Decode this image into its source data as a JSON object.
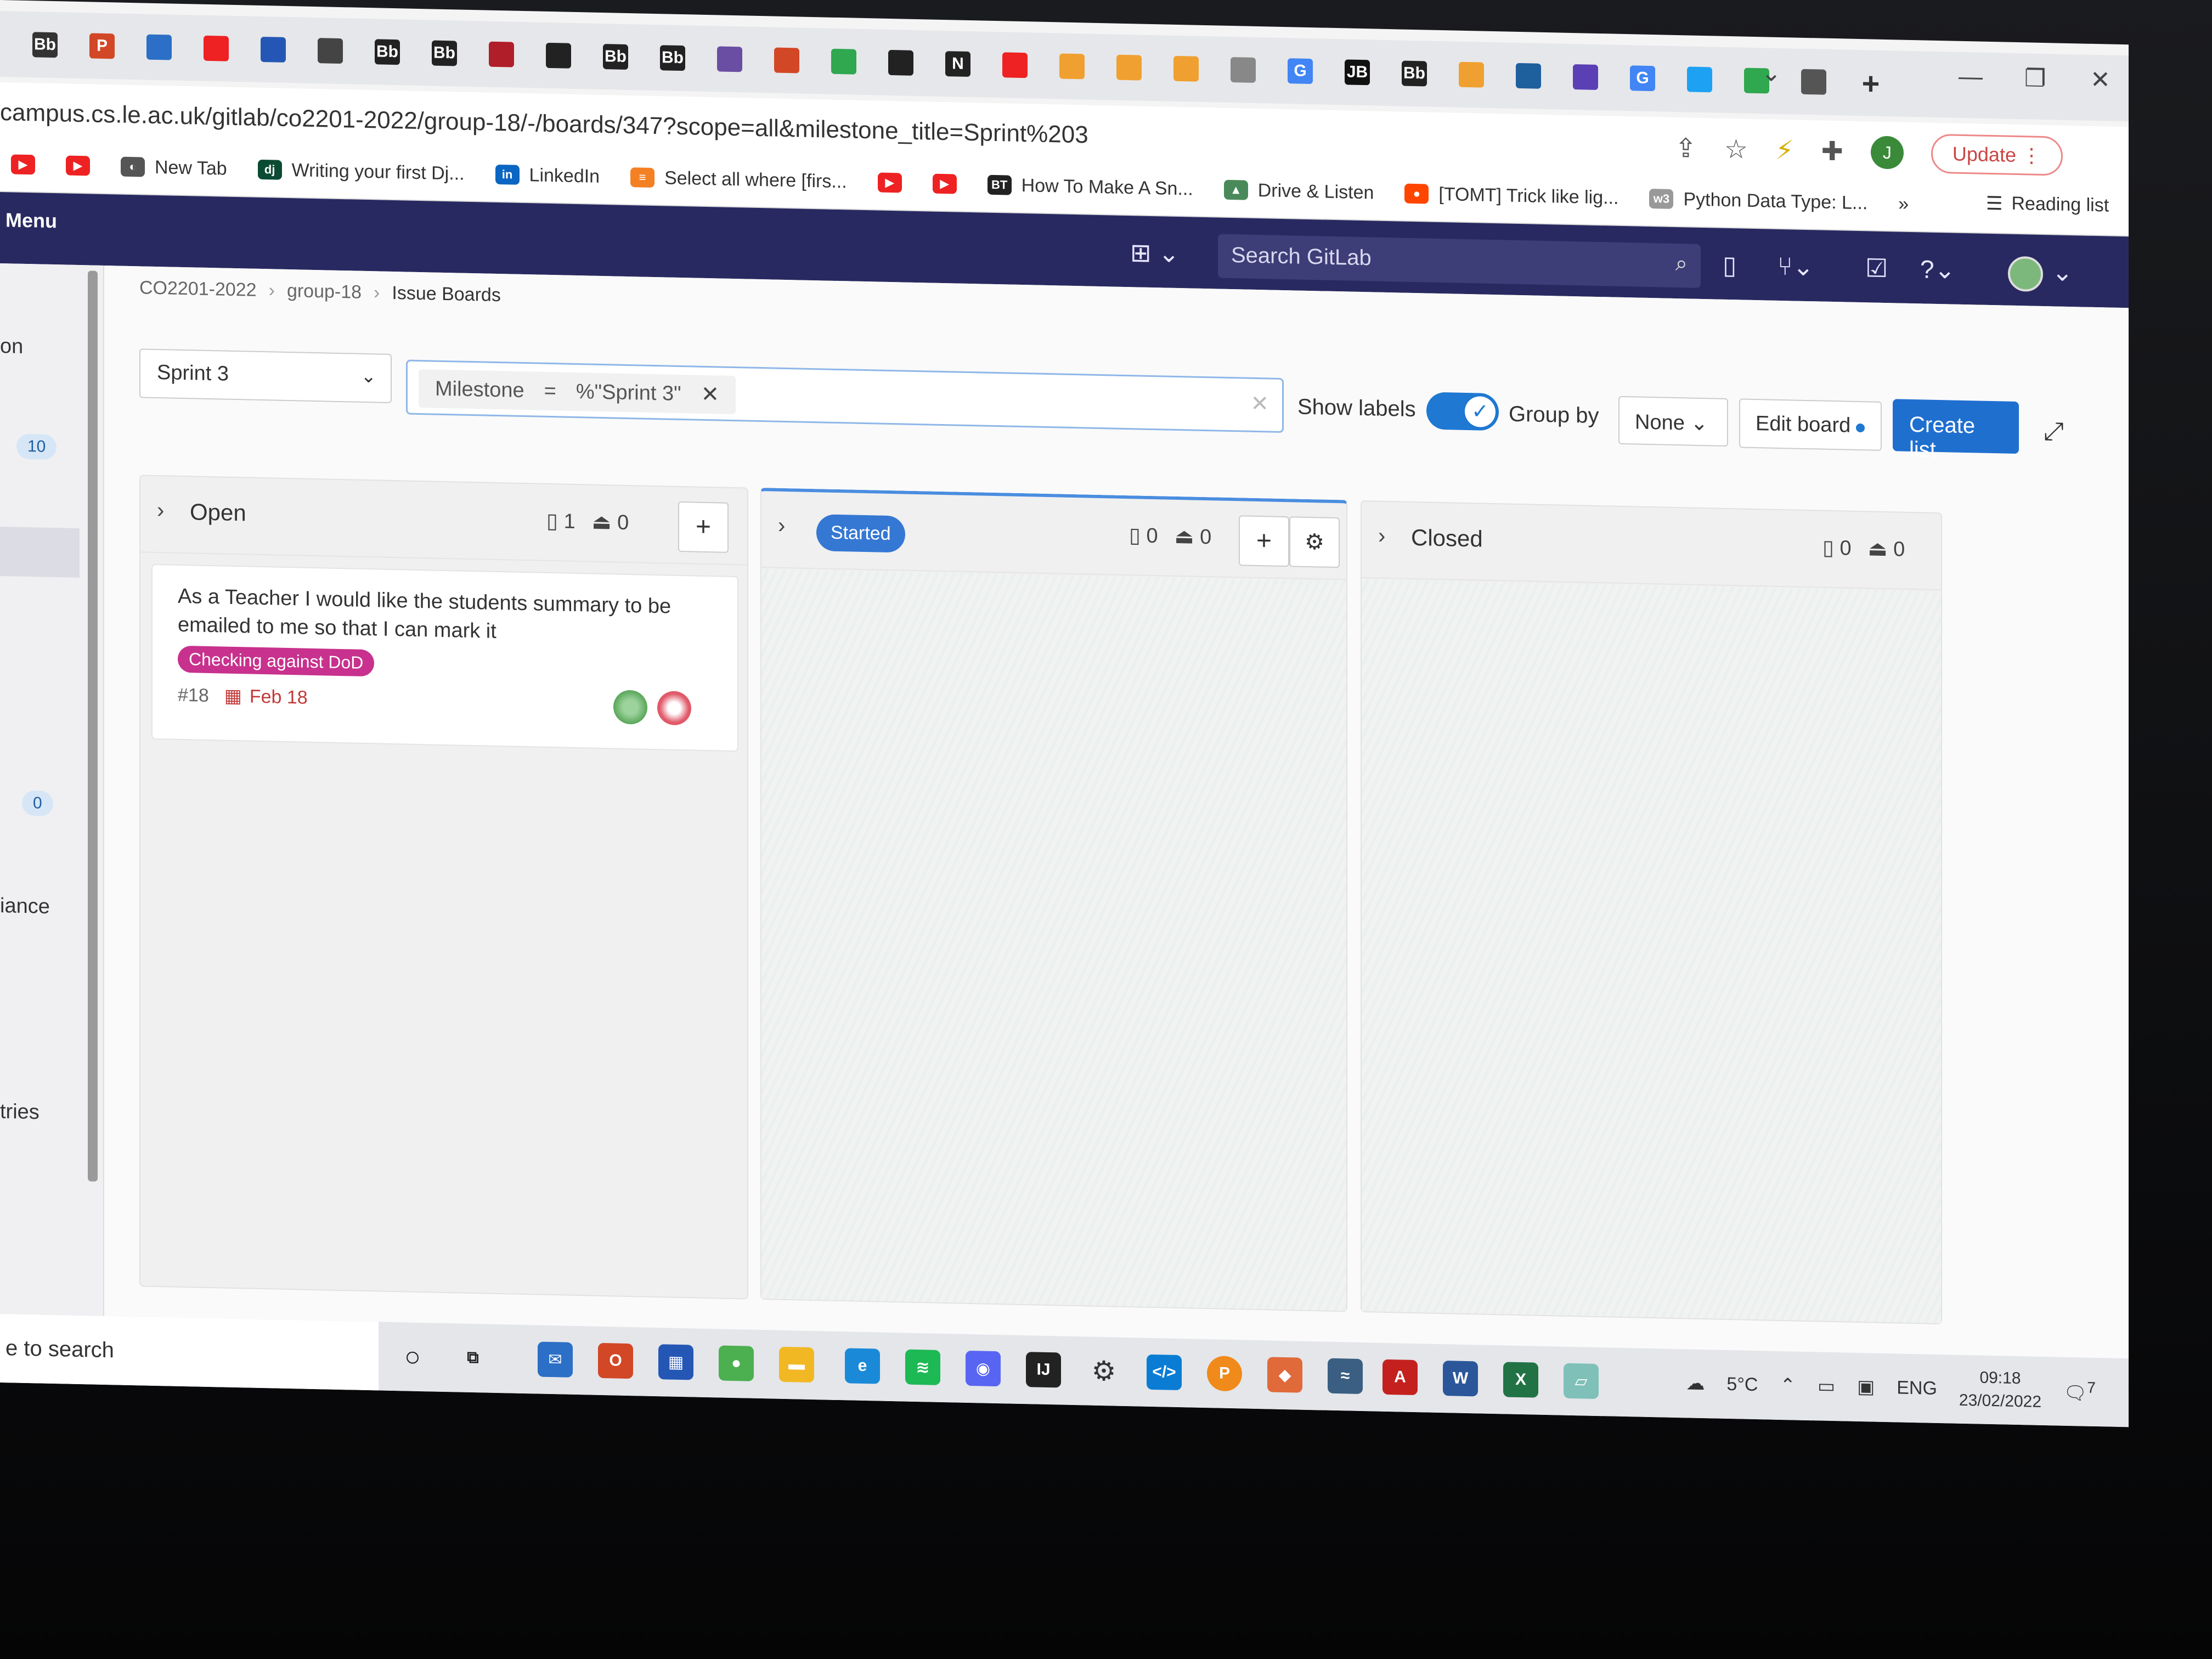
{
  "browser": {
    "url": "campus.cs.le.ac.uk/gitlab/co2201-2022/group-18/-/boards/347?scope=all&milestone_title=Sprint%203",
    "update_label": "Update",
    "profile_initial": "J",
    "reading_list": "Reading list",
    "tab_favicons": [
      "Bb",
      "P",
      "",
      "",
      "",
      "",
      "Bb",
      "Bb",
      "",
      "",
      "Bb",
      "Bb",
      "",
      "",
      "",
      "",
      "N",
      "",
      "",
      "",
      "",
      "",
      "G",
      "JB",
      "Bb",
      "",
      "",
      "",
      "G",
      "",
      "",
      ""
    ],
    "bookmarks": [
      {
        "icon": "youtube-icon",
        "label": ""
      },
      {
        "icon": "youtube-icon",
        "label": ""
      },
      {
        "icon": "globe-icon",
        "label": "New Tab"
      },
      {
        "icon": "django-icon",
        "label": "Writing your first Dj..."
      },
      {
        "icon": "linkedin-icon",
        "label": "LinkedIn"
      },
      {
        "icon": "stackoverflow-icon",
        "label": "Select all where [firs..."
      },
      {
        "icon": "youtube-icon",
        "label": ""
      },
      {
        "icon": "youtube-icon",
        "label": ""
      },
      {
        "icon": "btw-icon",
        "label": "How To Make A Sn..."
      },
      {
        "icon": "drive-icon",
        "label": "Drive & Listen"
      },
      {
        "icon": "reddit-icon",
        "label": "[TOMT] Trick like lig..."
      },
      {
        "icon": "w3-icon",
        "label": "Python Data Type: L..."
      }
    ]
  },
  "gitlab": {
    "menu_label": "Menu",
    "search_placeholder": "Search GitLab",
    "breadcrumb": [
      "CO2201-2022",
      "group-18",
      "Issue Boards"
    ],
    "milestone_select": "Sprint 3",
    "filter_token": {
      "key": "Milestone",
      "op": "=",
      "value": "%\"Sprint 3\""
    },
    "show_labels": "Show labels",
    "group_by": "Group by",
    "group_by_value": "None",
    "edit_board": "Edit board",
    "create_list": "Create list",
    "sidebar": {
      "item_top": "on",
      "badge_1": "10",
      "badge_2": "0",
      "item_mid": "iance",
      "item_bottom": "tries"
    },
    "lists": [
      {
        "title": "Open",
        "issues": "1",
        "weight": "0"
      },
      {
        "title": "Started",
        "issues": "0",
        "weight": "0"
      },
      {
        "title": "Closed",
        "issues": "0",
        "weight": "0"
      }
    ],
    "issue": {
      "title": "As a Teacher I would like the students summary to be emailed to me so that I can mark it",
      "label": "Checking against DoD",
      "label_color": "#c8318d",
      "number": "#18",
      "due": "Feb 18"
    }
  },
  "taskbar": {
    "search": "e to search",
    "weather": "5°C",
    "lang": "ENG",
    "time": "09:18",
    "date": "23/02/2022",
    "notif_count": "7"
  }
}
